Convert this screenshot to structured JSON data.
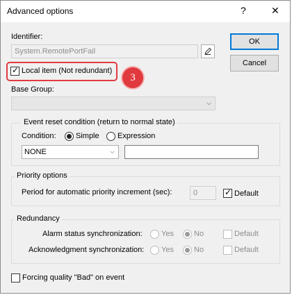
{
  "window": {
    "title": "Advanced options",
    "help_symbol": "?",
    "close_symbol": "✕"
  },
  "identifier": {
    "label": "Identifier:",
    "value": "System.RemotePortFail",
    "edit_icon": "pencil-icon"
  },
  "buttons": {
    "ok": "OK",
    "cancel": "Cancel"
  },
  "local_item": {
    "label": "Local item (Not redundant)",
    "checked": true
  },
  "annotation": {
    "number": "3",
    "color": "#e03a3e"
  },
  "base_group": {
    "label": "Base Group:",
    "value": ""
  },
  "event_reset": {
    "title": "Event reset condition (return to normal state)",
    "condition_label": "Condition:",
    "simple_label": "Simple",
    "expression_label": "Expression",
    "selected": "Simple",
    "dropdown_value": "NONE",
    "text_value": ""
  },
  "priority": {
    "title": "Priority options",
    "period_label": "Period for automatic priority increment (sec):",
    "period_value": "0",
    "default_label": "Default",
    "default_checked": true
  },
  "redundancy": {
    "title": "Redundancy",
    "alarm_label": "Alarm status synchronization:",
    "ack_label": "Acknowledgment synchronization:",
    "yes_label": "Yes",
    "no_label": "No",
    "default_label": "Default",
    "alarm_selected": "No",
    "ack_selected": "No"
  },
  "forcing": {
    "label": "Forcing quality \"Bad\" on event",
    "checked": false
  }
}
